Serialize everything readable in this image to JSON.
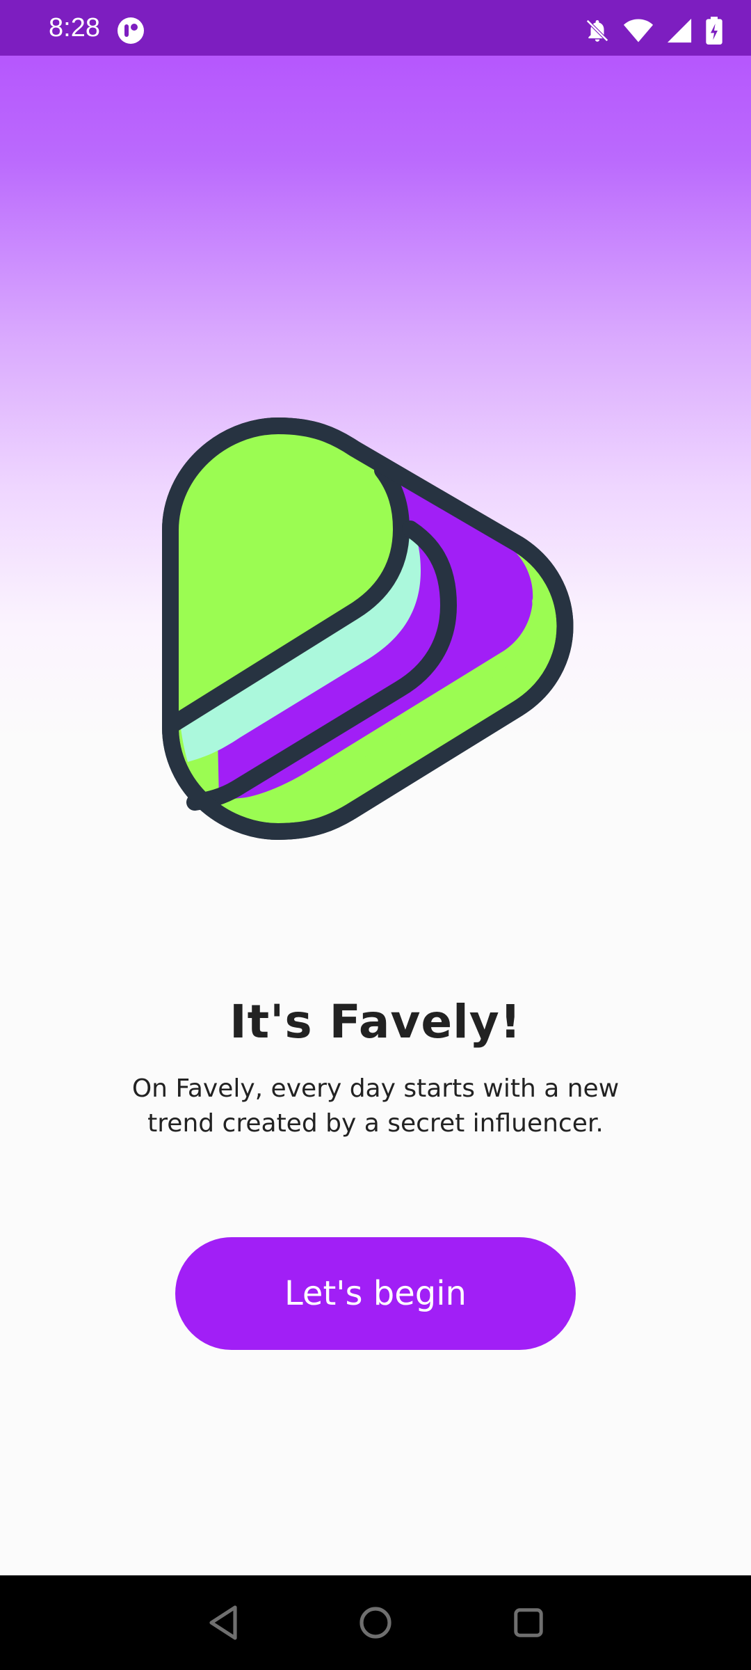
{
  "status_bar": {
    "time": "8:28",
    "icons": [
      "app-notification-icon",
      "notifications-off-icon",
      "wifi-icon",
      "cellular-signal-icon",
      "battery-charging-icon"
    ]
  },
  "onboarding": {
    "title": "It's Favely!",
    "subtitle": "On Favely, every day starts with a new trend created by a secret influencer.",
    "cta_label": "Let's begin"
  },
  "colors": {
    "accent": "#a11ff6",
    "status_bar": "#7d1ec0",
    "logo_green": "#9bfc52",
    "logo_mint": "#abf8dc",
    "logo_purple": "#a11ff6",
    "logo_outline": "#273341"
  },
  "nav_bar": {
    "buttons": [
      "back-icon",
      "home-icon",
      "recents-icon"
    ]
  }
}
